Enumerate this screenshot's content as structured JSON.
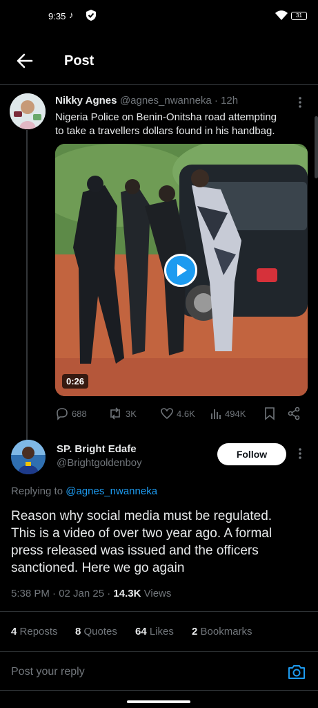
{
  "status_bar": {
    "time": "9:35",
    "battery": "31"
  },
  "header": {
    "title": "Post"
  },
  "original_post": {
    "author_name": "Nikky Agnes",
    "handle_time": "@agnes_nwanneka · 12h",
    "text_line1": "Nigeria Police on Benin-Onitsha road attempting",
    "text_line2": "to take a travellers dollars found in his handbag.",
    "video_duration": "0:26",
    "replies": "688",
    "reposts": "3K",
    "likes": "4.6K",
    "views": "494K"
  },
  "reply": {
    "author_name": "SP. Bright Edafe",
    "handle": "@Brightgoldenboy",
    "follow_label": "Follow",
    "replying_prefix": "Replying to",
    "replying_handle": "@agnes_nwanneka",
    "text_line1": "Reason why social media must be regulated.",
    "text_line2": "This is a video of over two year ago. A formal",
    "text_line3": "press released was issued and the officers",
    "text_line4": "sanctioned. Here we go again",
    "timestamp": "5:38 PM · 02 Jan 25 ·",
    "views_count": "14.3K",
    "views_label": "Views"
  },
  "stats": [
    {
      "count": "4",
      "label": "Reposts"
    },
    {
      "count": "8",
      "label": "Quotes"
    },
    {
      "count": "64",
      "label": "Likes"
    },
    {
      "count": "2",
      "label": "Bookmarks"
    }
  ],
  "reply_bar": {
    "placeholder": "Post your reply"
  },
  "colors": {
    "accent": "#1d9bf0",
    "background": "#000000",
    "muted": "#71767b"
  },
  "icons": [
    "back-arrow-icon",
    "more-icon",
    "reply-icon",
    "repost-icon",
    "like-icon",
    "views-icon",
    "bookmark-icon",
    "share-icon",
    "camera-icon",
    "play-icon"
  ]
}
